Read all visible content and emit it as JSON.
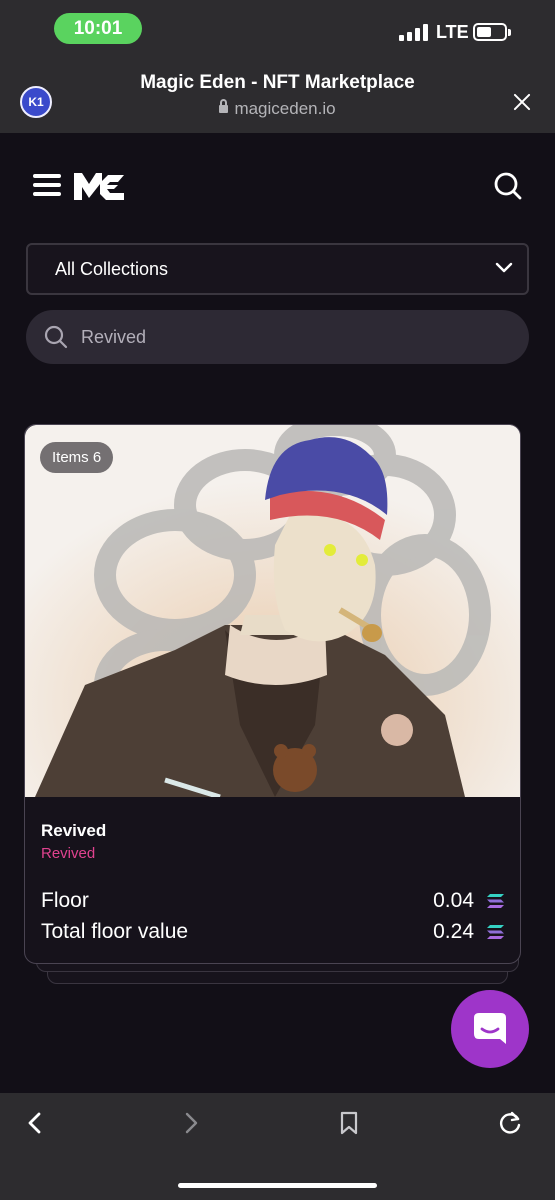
{
  "status_bar": {
    "time": "10:01",
    "network": "LTE"
  },
  "browser": {
    "tab_badge": "K1",
    "title": "Magic Eden - NFT Marketplace",
    "url": "magiceden.io"
  },
  "site_nav": {
    "logo": "ME"
  },
  "filters": {
    "collection_select": "All Collections",
    "search_value": "Revived"
  },
  "card": {
    "items_badge": "Items 6",
    "name": "Revived",
    "subtitle": "Revived",
    "stats": [
      {
        "label": "Floor",
        "value": "0.04"
      },
      {
        "label": "Total floor value",
        "value": "0.24"
      }
    ]
  },
  "icons": [
    "menu-icon",
    "magic-eden-logo",
    "search-icon",
    "chevron-down-icon",
    "solana-icon",
    "chat-icon",
    "back-icon",
    "forward-icon",
    "bookmark-icon",
    "reload-icon",
    "lock-icon",
    "close-icon"
  ],
  "colors": {
    "background": "#120f17",
    "accent_pink": "#e0428f",
    "chat_purple": "#9e35c9",
    "status_green": "#5ad35f"
  }
}
